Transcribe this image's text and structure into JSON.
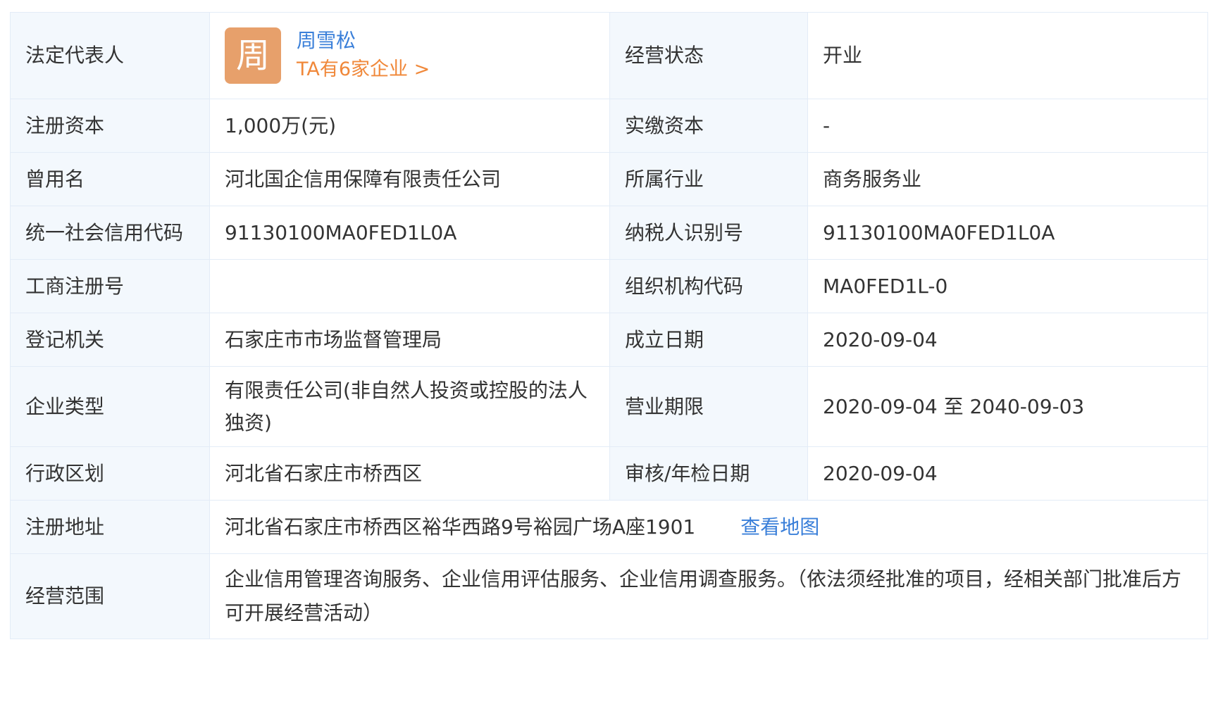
{
  "rows": {
    "legal_rep": {
      "label": "法定代表人",
      "avatar_char": "周",
      "name": "周雪松",
      "companies_link": "TA有6家企业 >",
      "label2": "经营状态",
      "value2": "开业"
    },
    "capital": {
      "label": "注册资本",
      "value": "1,000万(元)",
      "label2": "实缴资本",
      "value2": "-"
    },
    "former_name": {
      "label": "曾用名",
      "value": "河北国企信用保障有限责任公司",
      "label2": "所属行业",
      "value2": "商务服务业"
    },
    "credit_code": {
      "label": "统一社会信用代码",
      "value": "91130100MA0FED1L0A",
      "label2": "纳税人识别号",
      "value2": "91130100MA0FED1L0A"
    },
    "reg_no": {
      "label": "工商注册号",
      "value": "",
      "label2": "组织机构代码",
      "value2": "MA0FED1L-0"
    },
    "authority": {
      "label": "登记机关",
      "value": "石家庄市市场监督管理局",
      "label2": "成立日期",
      "value2": "2020-09-04"
    },
    "company_type": {
      "label": "企业类型",
      "value": "有限责任公司(非自然人投资或控股的法人独资)",
      "label2": "营业期限",
      "value2": "2020-09-04 至 2040-09-03"
    },
    "district": {
      "label": "行政区划",
      "value": "河北省石家庄市桥西区",
      "label2": "审核/年检日期",
      "value2": "2020-09-04"
    },
    "address": {
      "label": "注册地址",
      "value": "河北省石家庄市桥西区裕华西路9号裕园广场A座1901",
      "map_link": "查看地图"
    },
    "scope": {
      "label": "经营范围",
      "value": "企业信用管理咨询服务、企业信用评估服务、企业信用调查服务。（依法须经批准的项目，经相关部门批准后方可开展经营活动）"
    }
  },
  "colors": {
    "label_bg": "#f3f8fd",
    "border": "#e3ecf7",
    "link_blue": "#3a7fd9",
    "link_orange": "#f0883a",
    "avatar_bg": "#e7a06b"
  }
}
